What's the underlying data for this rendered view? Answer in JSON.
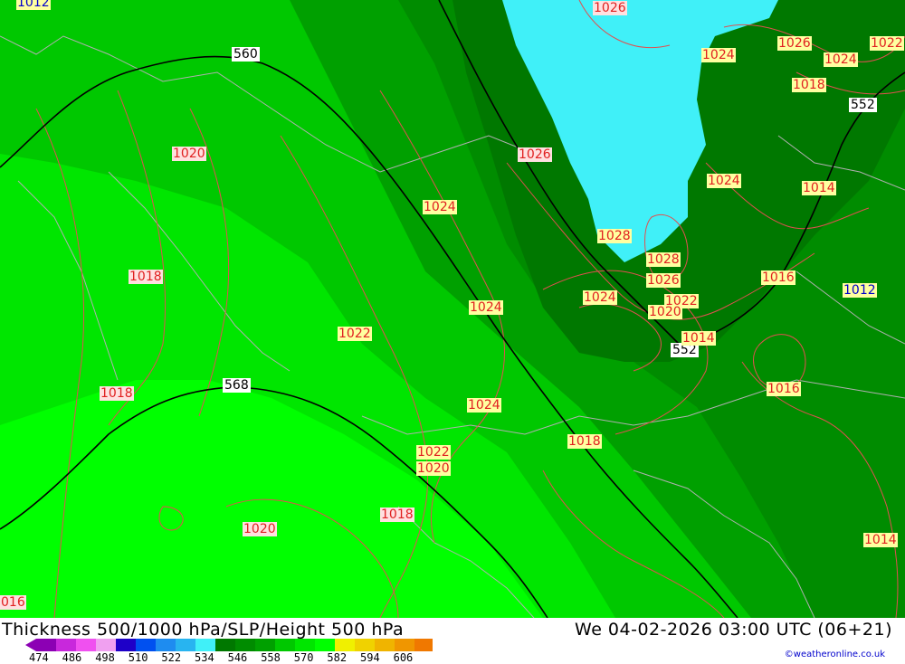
{
  "map": {
    "colors": {
      "water": "#40f0f8",
      "g546": "#007800",
      "g552": "#008c00",
      "g558": "#00a000",
      "g564": "#00c800",
      "g570": "#00e600",
      "g576": "#00ff00",
      "isobar": "#e05050",
      "height": "#000000",
      "borders": "#b0b0b0"
    },
    "height_labels": [
      "560",
      "568",
      "552",
      "552"
    ],
    "pressure_labels": [
      "1012",
      "1026",
      "1026",
      "1024",
      "1022",
      "1024",
      "1018",
      "1020",
      "1026",
      "1024",
      "1014",
      "1024",
      "1018",
      "1028",
      "1028",
      "1026",
      "1024",
      "1022",
      "1020",
      "1016",
      "1012",
      "1024",
      "1022",
      "1014",
      "1018",
      "1016",
      "1024",
      "1022",
      "1020",
      "1018",
      "1018",
      "1020",
      "1014",
      "016"
    ]
  },
  "footer": {
    "title": "Thickness 500/1000 hPa/SLP/Height 500 hPa",
    "datetime": "We 04-02-2026 03:00 UTC (06+21)",
    "credit": "©weatheronline.co.uk",
    "scale_ticks": [
      "474",
      "486",
      "498",
      "510",
      "522",
      "534",
      "546",
      "558",
      "570",
      "582",
      "594",
      "606"
    ],
    "scale_colors": [
      "#8c00b4",
      "#c828dc",
      "#f050f0",
      "#f0a0f0",
      "#1e00c8",
      "#0050f0",
      "#1e8cf0",
      "#28b4f0",
      "#40f0f8",
      "#007800",
      "#008c00",
      "#00a000",
      "#00c800",
      "#00e600",
      "#00ff00",
      "#f0f000",
      "#f0d200",
      "#f0b400",
      "#f09600",
      "#f07800"
    ]
  }
}
